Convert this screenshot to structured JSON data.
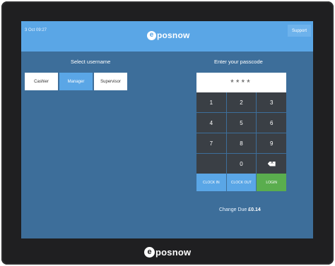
{
  "topbar": {
    "datetime": "3 Oct 09:27",
    "logo_mark": "e",
    "logo_text": "posnow",
    "support_label": "Support"
  },
  "users": {
    "title": "Select username",
    "items": [
      {
        "label": "Cashier",
        "selected": false
      },
      {
        "label": "Manager",
        "selected": true
      },
      {
        "label": "Supervisor",
        "selected": false
      }
    ]
  },
  "passcode": {
    "title": "Enter your passcode",
    "masked_value": "****",
    "keys": [
      "1",
      "2",
      "3",
      "4",
      "5",
      "6",
      "7",
      "8",
      "9",
      "",
      "0",
      "backspace-icon"
    ],
    "clock_in_label": "CLOCK IN",
    "clock_out_label": "CLOCK OUT",
    "login_label": "LOGIN"
  },
  "change_due": {
    "label": "Change Due",
    "amount": "£0.14"
  },
  "bezel": {
    "logo_mark": "e",
    "logo_text": "posnow"
  },
  "colors": {
    "screen_bg": "#3d6e9a",
    "accent": "#5aa6e6",
    "keypad": "#3a3f45",
    "login": "#5aad4e",
    "bezel": "#1f1f21"
  }
}
